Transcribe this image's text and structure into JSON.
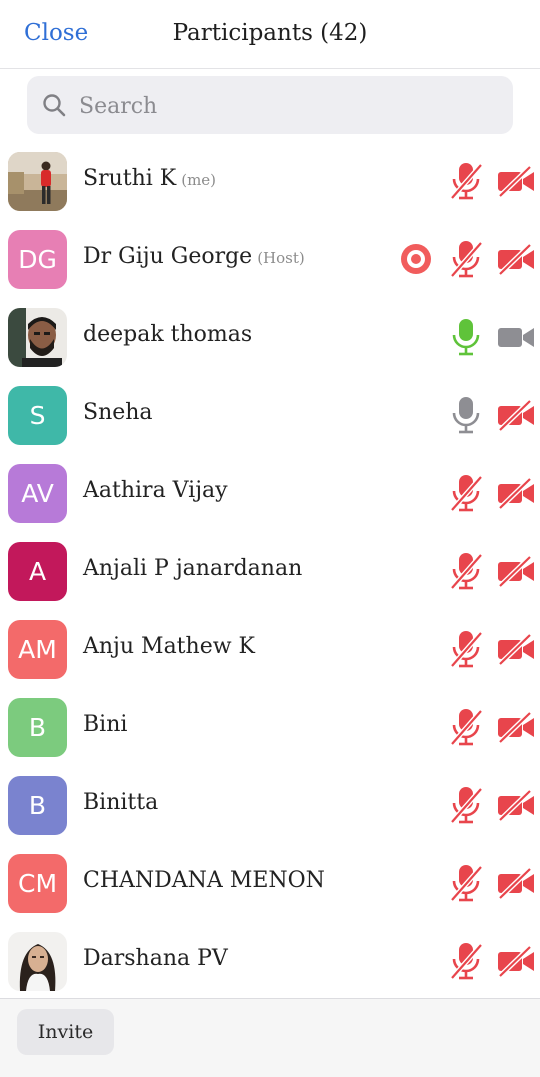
{
  "header": {
    "close_label": "Close",
    "title": "Participants (42)"
  },
  "search": {
    "placeholder": "Search",
    "value": ""
  },
  "participants": [
    {
      "name": "Sruthi K",
      "role": "(me)",
      "initials": "",
      "avatar": "photo-woman-outdoor",
      "mic": "muted",
      "video": "off",
      "recording": false
    },
    {
      "name": "Dr Giju George",
      "role": "(Host)",
      "initials": "DG",
      "avatar_color": "#e77fb4",
      "mic": "muted",
      "video": "off",
      "recording": true
    },
    {
      "name": "deepak thomas",
      "role": "",
      "initials": "",
      "avatar": "photo-man-beard",
      "mic": "active",
      "video": "on",
      "recording": false
    },
    {
      "name": "Sneha",
      "role": "",
      "initials": "S",
      "avatar_color": "#3fb8a8",
      "mic": "unmuted",
      "video": "off",
      "recording": false
    },
    {
      "name": "Aathira Vijay",
      "role": "",
      "initials": "AV",
      "avatar_color": "#b77ad8",
      "mic": "muted",
      "video": "off",
      "recording": false
    },
    {
      "name": "Anjali P janardanan",
      "role": "",
      "initials": "A",
      "avatar_color": "#c2185b",
      "mic": "muted",
      "video": "off",
      "recording": false
    },
    {
      "name": "Anju Mathew K",
      "role": "",
      "initials": "AM",
      "avatar_color": "#f36a6a",
      "mic": "muted",
      "video": "off",
      "recording": false
    },
    {
      "name": "Bini",
      "role": "",
      "initials": "B",
      "avatar_color": "#7ccb7e",
      "mic": "muted",
      "video": "off",
      "recording": false
    },
    {
      "name": "Binitta",
      "role": "",
      "initials": "B",
      "avatar_color": "#7a83cf",
      "mic": "muted",
      "video": "off",
      "recording": false
    },
    {
      "name": "CHANDANA MENON",
      "role": "",
      "initials": "CM",
      "avatar_color": "#f36a6a",
      "mic": "muted",
      "video": "off",
      "recording": false
    },
    {
      "name": "Darshana PV",
      "role": "",
      "initials": "",
      "avatar": "photo-woman-portrait",
      "mic": "muted",
      "video": "off",
      "recording": false
    }
  ],
  "footer": {
    "invite_label": "Invite"
  },
  "colors": {
    "accent": "#2f6fd6",
    "muted_red": "#e8454c",
    "active_green": "#5fc33a",
    "neutral_gray": "#8e8e93"
  }
}
